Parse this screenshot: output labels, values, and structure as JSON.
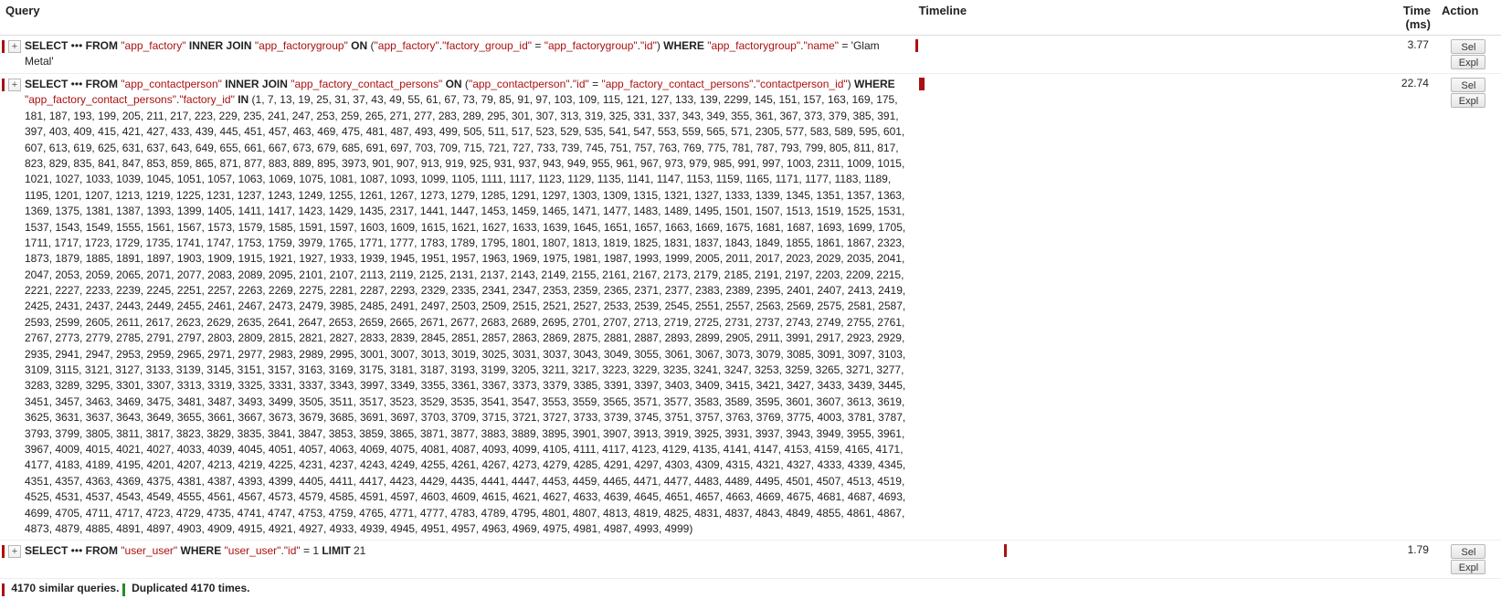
{
  "headers": {
    "query": "Query",
    "timeline": "Timeline",
    "time": "Time (ms)",
    "action": "Action"
  },
  "buttons": {
    "sel": "Sel",
    "expl": "Expl"
  },
  "queries": [
    {
      "time_ms": "3.77",
      "timeline": {
        "left_pct": 0.5,
        "width_pct": 0.6
      },
      "sql_parts": [
        {
          "t": "kw",
          "v": "SELECT"
        },
        {
          "t": "txt",
          "v": " ••• "
        },
        {
          "t": "kw",
          "v": "FROM"
        },
        {
          "t": "txt",
          "v": " "
        },
        {
          "t": "str",
          "v": "\"app_factory\""
        },
        {
          "t": "txt",
          "v": " "
        },
        {
          "t": "kw",
          "v": "INNER JOIN"
        },
        {
          "t": "txt",
          "v": " "
        },
        {
          "t": "str",
          "v": "\"app_factorygroup\""
        },
        {
          "t": "txt",
          "v": " "
        },
        {
          "t": "kw",
          "v": "ON"
        },
        {
          "t": "txt",
          "v": " ("
        },
        {
          "t": "str",
          "v": "\"app_factory\""
        },
        {
          "t": "txt",
          "v": "."
        },
        {
          "t": "str",
          "v": "\"factory_group_id\""
        },
        {
          "t": "txt",
          "v": " = "
        },
        {
          "t": "str",
          "v": "\"app_factorygroup\""
        },
        {
          "t": "txt",
          "v": "."
        },
        {
          "t": "str",
          "v": "\"id\""
        },
        {
          "t": "txt",
          "v": ") "
        },
        {
          "t": "kw",
          "v": "WHERE"
        },
        {
          "t": "txt",
          "v": " "
        },
        {
          "t": "str",
          "v": "\"app_factorygroup\""
        },
        {
          "t": "txt",
          "v": "."
        },
        {
          "t": "str",
          "v": "\"name\""
        },
        {
          "t": "txt",
          "v": " = 'Glam Metal'"
        }
      ]
    },
    {
      "time_ms": "22.74",
      "timeline": {
        "left_pct": 1.2,
        "width_pct": 1.2
      },
      "sql_parts": [
        {
          "t": "kw",
          "v": "SELECT"
        },
        {
          "t": "txt",
          "v": " ••• "
        },
        {
          "t": "kw",
          "v": "FROM"
        },
        {
          "t": "txt",
          "v": " "
        },
        {
          "t": "str",
          "v": "\"app_contactperson\""
        },
        {
          "t": "txt",
          "v": " "
        },
        {
          "t": "kw",
          "v": "INNER JOIN"
        },
        {
          "t": "txt",
          "v": " "
        },
        {
          "t": "str",
          "v": "\"app_factory_contact_persons\""
        },
        {
          "t": "txt",
          "v": " "
        },
        {
          "t": "kw",
          "v": "ON"
        },
        {
          "t": "txt",
          "v": " ("
        },
        {
          "t": "str",
          "v": "\"app_contactperson\""
        },
        {
          "t": "txt",
          "v": "."
        },
        {
          "t": "str",
          "v": "\"id\""
        },
        {
          "t": "txt",
          "v": " = "
        },
        {
          "t": "str",
          "v": "\"app_factory_contact_persons\""
        },
        {
          "t": "txt",
          "v": "."
        },
        {
          "t": "str",
          "v": "\"contactperson_id\""
        },
        {
          "t": "txt",
          "v": ") "
        },
        {
          "t": "kw",
          "v": "WHERE"
        },
        {
          "t": "txt",
          "v": " "
        },
        {
          "t": "str",
          "v": "\"app_factory_contact_persons\""
        },
        {
          "t": "txt",
          "v": "."
        },
        {
          "t": "str",
          "v": "\"factory_id\""
        },
        {
          "t": "txt",
          "v": " "
        },
        {
          "t": "kw",
          "v": "IN"
        },
        {
          "t": "txt",
          "v": " (1, 7, 13, 19, 25, 31, 37, 43, 49, 55, 61, 67, 73, 79, 85, 91, 97, 103, 109, 115, 121, 127, 133, 139, 2299, 145, 151, 157, 163, 169, 175, 181, 187, 193, 199, 205, 211, 217, 223, 229, 235, 241, 247, 253, 259, 265, 271, 277, 283, 289, 295, 301, 307, 313, 319, 325, 331, 337, 343, 349, 355, 361, 367, 373, 379, 385, 391, 397, 403, 409, 415, 421, 427, 433, 439, 445, 451, 457, 463, 469, 475, 481, 487, 493, 499, 505, 511, 517, 523, 529, 535, 541, 547, 553, 559, 565, 571, 2305, 577, 583, 589, 595, 601, 607, 613, 619, 625, 631, 637, 643, 649, 655, 661, 667, 673, 679, 685, 691, 697, 703, 709, 715, 721, 727, 733, 739, 745, 751, 757, 763, 769, 775, 781, 787, 793, 799, 805, 811, 817, 823, 829, 835, 841, 847, 853, 859, 865, 871, 877, 883, 889, 895, 3973, 901, 907, 913, 919, 925, 931, 937, 943, 949, 955, 961, 967, 973, 979, 985, 991, 997, 1003, 2311, 1009, 1015, 1021, 1027, 1033, 1039, 1045, 1051, 1057, 1063, 1069, 1075, 1081, 1087, 1093, 1099, 1105, 1111, 1117, 1123, 1129, 1135, 1141, 1147, 1153, 1159, 1165, 1171, 1177, 1183, 1189, 1195, 1201, 1207, 1213, 1219, 1225, 1231, 1237, 1243, 1249, 1255, 1261, 1267, 1273, 1279, 1285, 1291, 1297, 1303, 1309, 1315, 1321, 1327, 1333, 1339, 1345, 1351, 1357, 1363, 1369, 1375, 1381, 1387, 1393, 1399, 1405, 1411, 1417, 1423, 1429, 1435, 2317, 1441, 1447, 1453, 1459, 1465, 1471, 1477, 1483, 1489, 1495, 1501, 1507, 1513, 1519, 1525, 1531, 1537, 1543, 1549, 1555, 1561, 1567, 1573, 1579, 1585, 1591, 1597, 1603, 1609, 1615, 1621, 1627, 1633, 1639, 1645, 1651, 1657, 1663, 1669, 1675, 1681, 1687, 1693, 1699, 1705, 1711, 1717, 1723, 1729, 1735, 1741, 1747, 1753, 1759, 3979, 1765, 1771, 1777, 1783, 1789, 1795, 1801, 1807, 1813, 1819, 1825, 1831, 1837, 1843, 1849, 1855, 1861, 1867, 2323, 1873, 1879, 1885, 1891, 1897, 1903, 1909, 1915, 1921, 1927, 1933, 1939, 1945, 1951, 1957, 1963, 1969, 1975, 1981, 1987, 1993, 1999, 2005, 2011, 2017, 2023, 2029, 2035, 2041, 2047, 2053, 2059, 2065, 2071, 2077, 2083, 2089, 2095, 2101, 2107, 2113, 2119, 2125, 2131, 2137, 2143, 2149, 2155, 2161, 2167, 2173, 2179, 2185, 2191, 2197, 2203, 2209, 2215, 2221, 2227, 2233, 2239, 2245, 2251, 2257, 2263, 2269, 2275, 2281, 2287, 2293, 2329, 2335, 2341, 2347, 2353, 2359, 2365, 2371, 2377, 2383, 2389, 2395, 2401, 2407, 2413, 2419, 2425, 2431, 2437, 2443, 2449, 2455, 2461, 2467, 2473, 2479, 3985, 2485, 2491, 2497, 2503, 2509, 2515, 2521, 2527, 2533, 2539, 2545, 2551, 2557, 2563, 2569, 2575, 2581, 2587, 2593, 2599, 2605, 2611, 2617, 2623, 2629, 2635, 2641, 2647, 2653, 2659, 2665, 2671, 2677, 2683, 2689, 2695, 2701, 2707, 2713, 2719, 2725, 2731, 2737, 2743, 2749, 2755, 2761, 2767, 2773, 2779, 2785, 2791, 2797, 2803, 2809, 2815, 2821, 2827, 2833, 2839, 2845, 2851, 2857, 2863, 2869, 2875, 2881, 2887, 2893, 2899, 2905, 2911, 3991, 2917, 2923, 2929, 2935, 2941, 2947, 2953, 2959, 2965, 2971, 2977, 2983, 2989, 2995, 3001, 3007, 3013, 3019, 3025, 3031, 3037, 3043, 3049, 3055, 3061, 3067, 3073, 3079, 3085, 3091, 3097, 3103, 3109, 3115, 3121, 3127, 3133, 3139, 3145, 3151, 3157, 3163, 3169, 3175, 3181, 3187, 3193, 3199, 3205, 3211, 3217, 3223, 3229, 3235, 3241, 3247, 3253, 3259, 3265, 3271, 3277, 3283, 3289, 3295, 3301, 3307, 3313, 3319, 3325, 3331, 3337, 3343, 3997, 3349, 3355, 3361, 3367, 3373, 3379, 3385, 3391, 3397, 3403, 3409, 3415, 3421, 3427, 3433, 3439, 3445, 3451, 3457, 3463, 3469, 3475, 3481, 3487, 3493, 3499, 3505, 3511, 3517, 3523, 3529, 3535, 3541, 3547, 3553, 3559, 3565, 3571, 3577, 3583, 3589, 3595, 3601, 3607, 3613, 3619, 3625, 3631, 3637, 3643, 3649, 3655, 3661, 3667, 3673, 3679, 3685, 3691, 3697, 3703, 3709, 3715, 3721, 3727, 3733, 3739, 3745, 3751, 3757, 3763, 3769, 3775, 4003, 3781, 3787, 3793, 3799, 3805, 3811, 3817, 3823, 3829, 3835, 3841, 3847, 3853, 3859, 3865, 3871, 3877, 3883, 3889, 3895, 3901, 3907, 3913, 3919, 3925, 3931, 3937, 3943, 3949, 3955, 3961, 3967, 4009, 4015, 4021, 4027, 4033, 4039, 4045, 4051, 4057, 4063, 4069, 4075, 4081, 4087, 4093, 4099, 4105, 4111, 4117, 4123, 4129, 4135, 4141, 4147, 4153, 4159, 4165, 4171, 4177, 4183, 4189, 4195, 4201, 4207, 4213, 4219, 4225, 4231, 4237, 4243, 4249, 4255, 4261, 4267, 4273, 4279, 4285, 4291, 4297, 4303, 4309, 4315, 4321, 4327, 4333, 4339, 4345, 4351, 4357, 4363, 4369, 4375, 4381, 4387, 4393, 4399, 4405, 4411, 4417, 4423, 4429, 4435, 4441, 4447, 4453, 4459, 4465, 4471, 4477, 4483, 4489, 4495, 4501, 4507, 4513, 4519, 4525, 4531, 4537, 4543, 4549, 4555, 4561, 4567, 4573, 4579, 4585, 4591, 4597, 4603, 4609, 4615, 4621, 4627, 4633, 4639, 4645, 4651, 4657, 4663, 4669, 4675, 4681, 4687, 4693, 4699, 4705, 4711, 4717, 4723, 4729, 4735, 4741, 4747, 4753, 4759, 4765, 4771, 4777, 4783, 4789, 4795, 4801, 4807, 4813, 4819, 4825, 4831, 4837, 4843, 4849, 4855, 4861, 4867, 4873, 4879, 4885, 4891, 4897, 4903, 4909, 4915, 4921, 4927, 4933, 4939, 4945, 4951, 4957, 4963, 4969, 4975, 4981, 4987, 4993, 4999)"
        }
      ]
    },
    {
      "time_ms": "1.79",
      "timeline": {
        "left_pct": 20,
        "width_pct": 0.3
      },
      "sql_parts": [
        {
          "t": "kw",
          "v": "SELECT"
        },
        {
          "t": "txt",
          "v": " ••• "
        },
        {
          "t": "kw",
          "v": "FROM"
        },
        {
          "t": "txt",
          "v": " "
        },
        {
          "t": "str",
          "v": "\"user_user\""
        },
        {
          "t": "txt",
          "v": " "
        },
        {
          "t": "kw",
          "v": "WHERE"
        },
        {
          "t": "txt",
          "v": " "
        },
        {
          "t": "str",
          "v": "\"user_user\""
        },
        {
          "t": "txt",
          "v": "."
        },
        {
          "t": "str",
          "v": "\"id\""
        },
        {
          "t": "txt",
          "v": " = 1 "
        },
        {
          "t": "kw",
          "v": "LIMIT"
        },
        {
          "t": "txt",
          "v": " 21"
        }
      ]
    }
  ],
  "summary": {
    "similar": "4170 similar queries.",
    "duplicated": "Duplicated 4170 times."
  }
}
